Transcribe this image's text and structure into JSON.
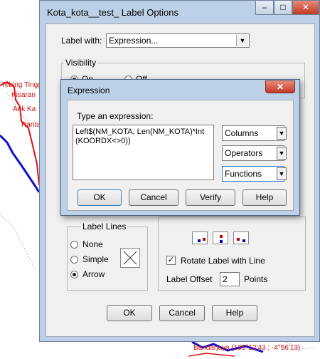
{
  "map_labels": [
    "Tebing Tingg",
    "Kisaran",
    "Aek Ka",
    "Ranta",
    "Bandarjaya (105°12'43 ; -4°56'13)"
  ],
  "label_options": {
    "title": "Kota_kota__test_ Label Options",
    "minimize": "–",
    "maximize": "□",
    "close": "✕",
    "label_with_label": "Label with:",
    "label_with_value": "Expression...",
    "visibility_label": "Visibility",
    "visibility_on": "On",
    "visibility_off": "Off",
    "label_lines_label": "Label Lines",
    "line_options": [
      {
        "label": "None",
        "selected": false
      },
      {
        "label": "Simple",
        "selected": false
      },
      {
        "label": "Arrow",
        "selected": true
      }
    ],
    "rotate_label": "Rotate Label with Line",
    "rotate_checked": true,
    "label_offset_label": "Label Offset",
    "label_offset_value": "2",
    "points_label": "Points",
    "ok": "OK",
    "cancel": "Cancel",
    "help": "Help"
  },
  "expression_dialog": {
    "title": "Expression",
    "close": "✕",
    "prompt": "Type an expression:",
    "expression": "Left$(NM_KOTA, Len(NM_KOTA)*Int(KOORDX<>0))",
    "dropdowns": [
      "Columns",
      "Operators",
      "Functions"
    ],
    "ok": "OK",
    "cancel": "Cancel",
    "verify": "Verify",
    "help": "Help"
  },
  "colors": {
    "road": "#1010d0",
    "boundary": "#e01010",
    "window_frame": "#bcd0e8"
  }
}
